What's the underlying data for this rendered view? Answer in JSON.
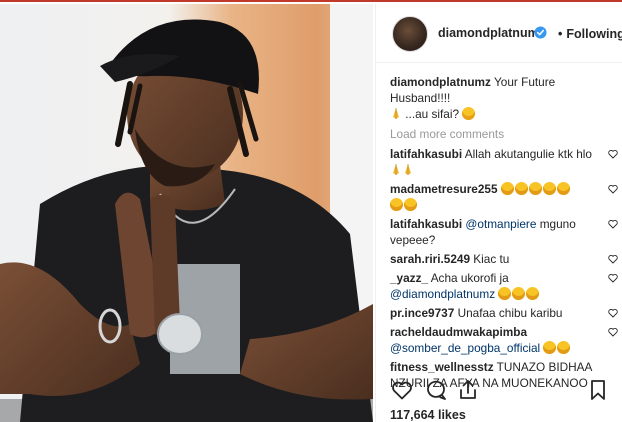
{
  "post": {
    "author": "diamondplatnumz",
    "follow_status": "Following",
    "caption_user": "diamondplatnumz",
    "caption_text": "Your Future Husband!!!!",
    "caption_text2": "...au sifai?",
    "load_more": "Load more comments",
    "likes": "117,664 likes"
  },
  "comments": [
    {
      "user": "latifahkasubi",
      "text": "Allah akutangulie ktk hlo",
      "emoji": "pray x2"
    },
    {
      "user": "madametresure255",
      "text": "",
      "emoji": "laugh x7"
    },
    {
      "user": "latifahkasubi",
      "mention": "@otmanpiere",
      "text": "mguno vepeee?"
    },
    {
      "user": "sarah.riri.5249",
      "text": "Kiac tu"
    },
    {
      "user": "_yazz_",
      "text": "Acha ukorofi ja",
      "mention": "@diamondplatnumz",
      "emoji": "laugh x3"
    },
    {
      "user": "pr.ince9737",
      "text": "Unafaa chibu karibu"
    },
    {
      "user": "racheldaudmwakapimba",
      "mention": "@somber_de_pogba_official",
      "emoji": "laugh x2"
    },
    {
      "user": "fitness_wellnesstz",
      "text": "TUNAZO BIDHAA NZURII ZA AFYA NA MUONEKANOO"
    }
  ],
  "colors": {
    "link": "#003569",
    "muted": "#999999",
    "verified": "#3897f0",
    "frame_top": "#c0392b"
  },
  "icons": [
    "heart-icon",
    "comment-icon",
    "share-icon",
    "bookmark-icon",
    "verified-badge-icon"
  ]
}
